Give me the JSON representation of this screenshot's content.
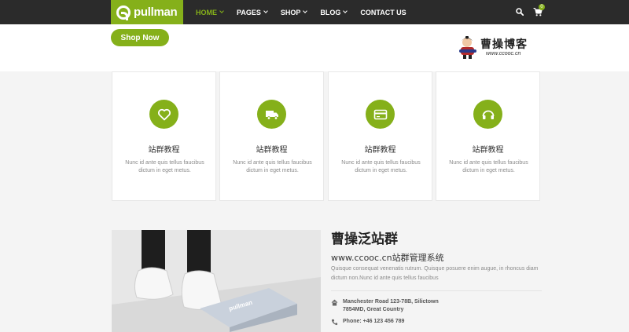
{
  "brand": {
    "name": "pullman",
    "color": "#85b01a"
  },
  "nav": {
    "items": [
      {
        "label": "HOME",
        "dropdown": true
      },
      {
        "label": "PAGES",
        "dropdown": true
      },
      {
        "label": "SHOP",
        "dropdown": true
      },
      {
        "label": "BLOG",
        "dropdown": true
      },
      {
        "label": "CONTACT US",
        "dropdown": false
      }
    ],
    "active": "HOME",
    "cart_count": "0"
  },
  "hero": {
    "shop_button": "Shop Now"
  },
  "watermark": {
    "title": "曹操博客",
    "url": "www.ccooc.cn"
  },
  "features": [
    {
      "icon": "heart-icon",
      "title": "站群教程",
      "desc": "Nunc id ante quis tellus faucibus dictum in eget metus."
    },
    {
      "icon": "truck-icon",
      "title": "站群教程",
      "desc": "Nunc id ante quis tellus faucibus dictum in eget metus."
    },
    {
      "icon": "credit-card-icon",
      "title": "站群教程",
      "desc": "Nunc id ante quis tellus faucibus dictum in eget metus."
    },
    {
      "icon": "headphones-icon",
      "title": "站群教程",
      "desc": "Nunc id ante quis tellus faucibus dictum in eget metus."
    }
  ],
  "about": {
    "title": "曹操泛站群",
    "subtitle": "www.ccooc.cn站群管理系统",
    "body": "Quisque consequat venenatis rutrum. Quisque posuere enim augue, in rhoncus diam dictum non.Nunc id ante quis tellus faucibus",
    "address": "Manchester Road 123-78B, Silictown 7854MD, Great Country",
    "phone": "Phone: +46 123 456 789"
  }
}
